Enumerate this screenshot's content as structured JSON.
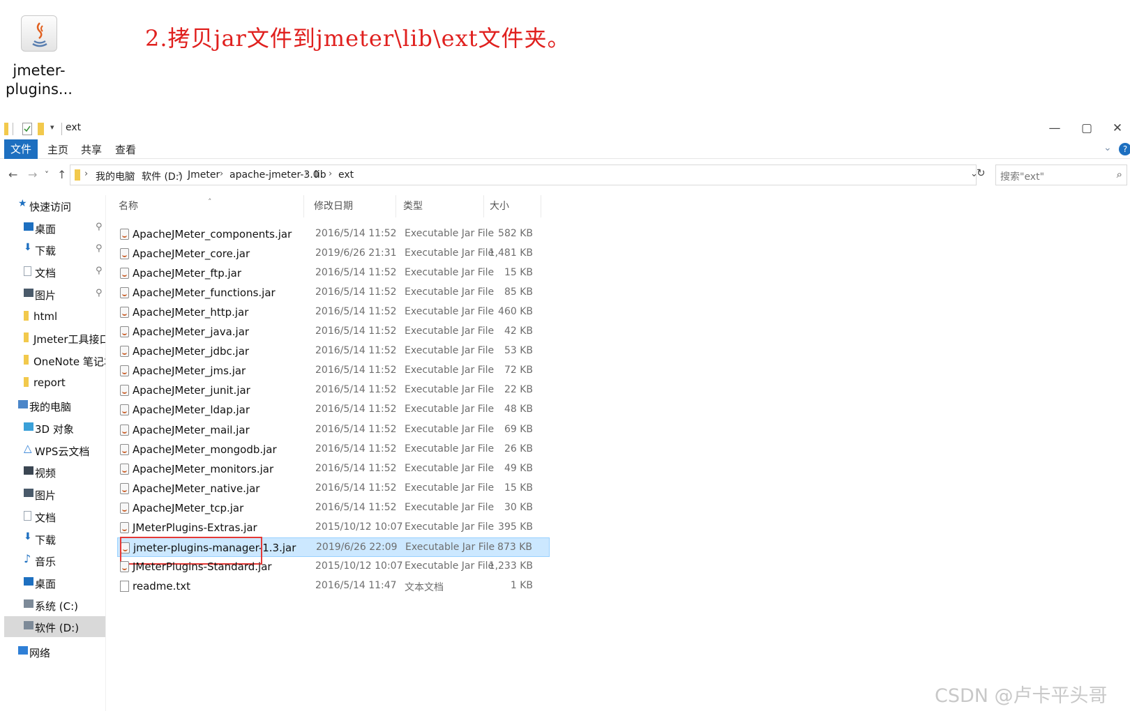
{
  "desktop_icon": {
    "label": "jmeter-\nplugins...",
    "icon": "java-jar-icon"
  },
  "annotation": "2.拷贝jar文件到jmeter\\lib\\ext文件夹。",
  "window": {
    "title": "ext",
    "controls": {
      "minimize": "—",
      "maximize": "▢",
      "close": "✕"
    }
  },
  "ribbon": {
    "file": "文件",
    "tabs": [
      "主页",
      "共享",
      "查看"
    ]
  },
  "address": {
    "back": "←",
    "forward": "→",
    "recent": "˅",
    "up": "↑",
    "crumbs": [
      "我的电脑",
      "软件 (D:)",
      "Jmeter",
      "apache-jmeter-3.0",
      "lib",
      "ext"
    ],
    "search_placeholder": "搜索\"ext\""
  },
  "sidebar": {
    "items": [
      {
        "label": "快速访问",
        "icon": "star-icon",
        "pinned": false,
        "indent": 0
      },
      {
        "label": "桌面",
        "icon": "desktop-icon",
        "pinned": true,
        "indent": 1
      },
      {
        "label": "下载",
        "icon": "download-icon",
        "pinned": true,
        "indent": 1
      },
      {
        "label": "文档",
        "icon": "document-icon",
        "pinned": true,
        "indent": 1
      },
      {
        "label": "图片",
        "icon": "pictures-icon",
        "pinned": true,
        "indent": 1
      },
      {
        "label": "html",
        "icon": "folder-icon",
        "pinned": false,
        "indent": 1
      },
      {
        "label": "Jmeter工具接口测",
        "icon": "folder-icon",
        "pinned": false,
        "indent": 1
      },
      {
        "label": "OneNote 笔记本",
        "icon": "folder-icon",
        "pinned": false,
        "indent": 1
      },
      {
        "label": "report",
        "icon": "folder-icon",
        "pinned": false,
        "indent": 1
      },
      {
        "label": "我的电脑",
        "icon": "computer-icon",
        "pinned": false,
        "indent": 0
      },
      {
        "label": "3D 对象",
        "icon": "3d-objects-icon",
        "pinned": false,
        "indent": 1
      },
      {
        "label": "WPS云文档",
        "icon": "cloud-icon",
        "pinned": false,
        "indent": 1
      },
      {
        "label": "视频",
        "icon": "video-icon",
        "pinned": false,
        "indent": 1
      },
      {
        "label": "图片",
        "icon": "pictures-icon",
        "pinned": false,
        "indent": 1
      },
      {
        "label": "文档",
        "icon": "document-icon",
        "pinned": false,
        "indent": 1
      },
      {
        "label": "下载",
        "icon": "download-icon",
        "pinned": false,
        "indent": 1
      },
      {
        "label": "音乐",
        "icon": "music-icon",
        "pinned": false,
        "indent": 1
      },
      {
        "label": "桌面",
        "icon": "desktop-icon",
        "pinned": false,
        "indent": 1
      },
      {
        "label": "系统 (C:)",
        "icon": "drive-icon",
        "pinned": false,
        "indent": 1
      },
      {
        "label": "软件 (D:)",
        "icon": "drive-icon",
        "pinned": false,
        "indent": 1,
        "selected": true
      },
      {
        "label": "网络",
        "icon": "network-icon",
        "pinned": false,
        "indent": 0
      }
    ]
  },
  "columns": {
    "name": "名称",
    "date": "修改日期",
    "type": "类型",
    "size": "大小"
  },
  "files": [
    {
      "name": "ApacheJMeter_components.jar",
      "date": "2016/5/14 11:52",
      "type": "Executable Jar File",
      "size": "582 KB"
    },
    {
      "name": "ApacheJMeter_core.jar",
      "date": "2019/6/26 21:31",
      "type": "Executable Jar File",
      "size": "1,481 KB"
    },
    {
      "name": "ApacheJMeter_ftp.jar",
      "date": "2016/5/14 11:52",
      "type": "Executable Jar File",
      "size": "15 KB"
    },
    {
      "name": "ApacheJMeter_functions.jar",
      "date": "2016/5/14 11:52",
      "type": "Executable Jar File",
      "size": "85 KB"
    },
    {
      "name": "ApacheJMeter_http.jar",
      "date": "2016/5/14 11:52",
      "type": "Executable Jar File",
      "size": "460 KB"
    },
    {
      "name": "ApacheJMeter_java.jar",
      "date": "2016/5/14 11:52",
      "type": "Executable Jar File",
      "size": "42 KB"
    },
    {
      "name": "ApacheJMeter_jdbc.jar",
      "date": "2016/5/14 11:52",
      "type": "Executable Jar File",
      "size": "53 KB"
    },
    {
      "name": "ApacheJMeter_jms.jar",
      "date": "2016/5/14 11:52",
      "type": "Executable Jar File",
      "size": "72 KB"
    },
    {
      "name": "ApacheJMeter_junit.jar",
      "date": "2016/5/14 11:52",
      "type": "Executable Jar File",
      "size": "22 KB"
    },
    {
      "name": "ApacheJMeter_ldap.jar",
      "date": "2016/5/14 11:52",
      "type": "Executable Jar File",
      "size": "48 KB"
    },
    {
      "name": "ApacheJMeter_mail.jar",
      "date": "2016/5/14 11:52",
      "type": "Executable Jar File",
      "size": "69 KB"
    },
    {
      "name": "ApacheJMeter_mongodb.jar",
      "date": "2016/5/14 11:52",
      "type": "Executable Jar File",
      "size": "26 KB"
    },
    {
      "name": "ApacheJMeter_monitors.jar",
      "date": "2016/5/14 11:52",
      "type": "Executable Jar File",
      "size": "49 KB"
    },
    {
      "name": "ApacheJMeter_native.jar",
      "date": "2016/5/14 11:52",
      "type": "Executable Jar File",
      "size": "15 KB"
    },
    {
      "name": "ApacheJMeter_tcp.jar",
      "date": "2016/5/14 11:52",
      "type": "Executable Jar File",
      "size": "30 KB"
    },
    {
      "name": "JMeterPlugins-Extras.jar",
      "date": "2015/10/12 10:07",
      "type": "Executable Jar File",
      "size": "395 KB"
    },
    {
      "name": "jmeter-plugins-manager-1.3.jar",
      "date": "2019/6/26 22:09",
      "type": "Executable Jar File",
      "size": "873 KB",
      "selected": true,
      "highlighted": true
    },
    {
      "name": "JMeterPlugins-Standard.jar",
      "date": "2015/10/12 10:07",
      "type": "Executable Jar File",
      "size": "1,233 KB"
    },
    {
      "name": "readme.txt",
      "date": "2016/5/14 11:47",
      "type": "文本文档",
      "size": "1 KB",
      "kind": "txt"
    }
  ],
  "watermark": "CSDN @卢卡平头哥",
  "colors": {
    "annotation": "#e0201e",
    "selection": "#cce8ff",
    "ribbon_file": "#1d6fc0",
    "highlight_box": "#e53935"
  }
}
